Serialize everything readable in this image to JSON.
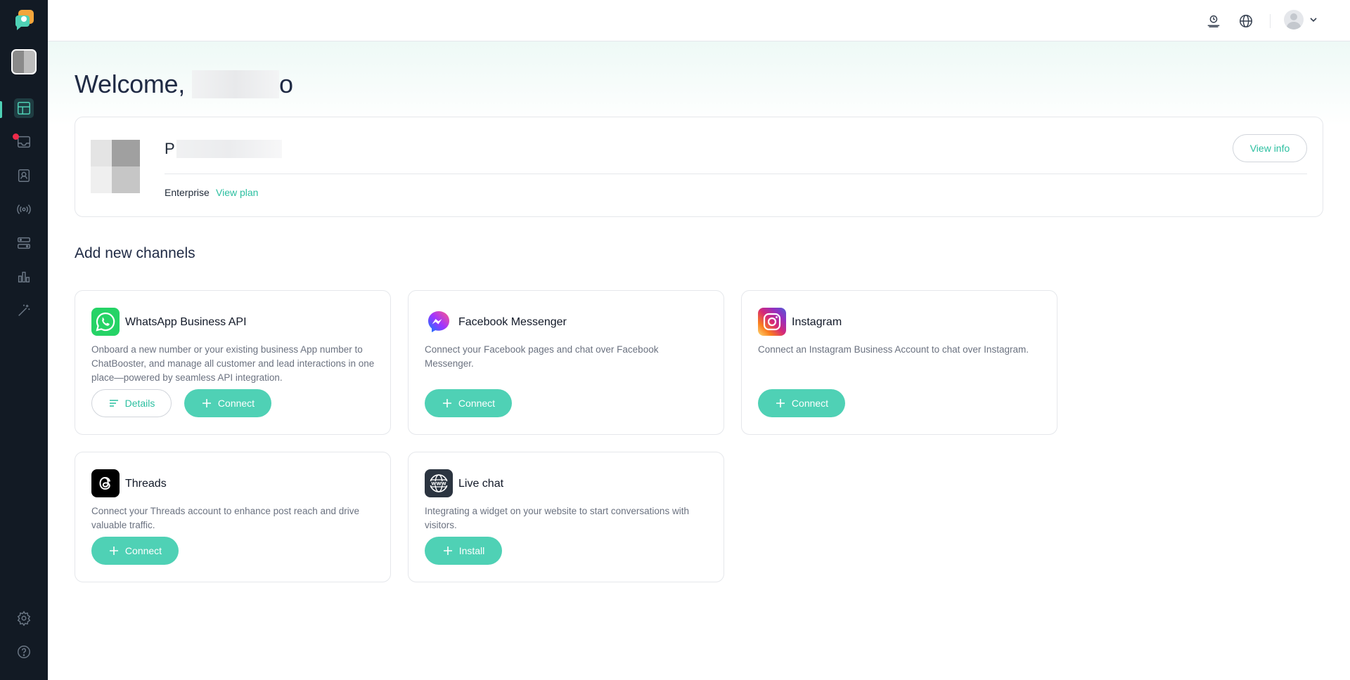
{
  "header": {
    "welcome_prefix": "Welcome,",
    "welcome_suffix": "o"
  },
  "account": {
    "name_initial": "P",
    "plan": "Enterprise",
    "view_plan_label": "View plan",
    "view_info_label": "View info"
  },
  "section": {
    "title": "Add new channels"
  },
  "channels": [
    {
      "title": "WhatsApp Business API",
      "description": "Onboard a new number or your existing business App number to ChatBooster, and manage all customer and lead interactions in one place—powered by seamless API integration.",
      "details_label": "Details",
      "action_label": "Connect",
      "icon": "whatsapp-icon"
    },
    {
      "title": "Facebook Messenger",
      "description": "Connect your Facebook pages and chat over Facebook Messenger.",
      "action_label": "Connect",
      "icon": "messenger-icon"
    },
    {
      "title": "Instagram",
      "description": "Connect an Instagram Business Account to chat over Instagram.",
      "action_label": "Connect",
      "icon": "instagram-icon"
    },
    {
      "title": "Threads",
      "description": "Connect your Threads account to enhance post reach and drive valuable traffic.",
      "action_label": "Connect",
      "icon": "threads-icon"
    },
    {
      "title": "Live chat",
      "description": "Integrating a widget on your website to start conversations with visitors.",
      "action_label": "Install",
      "icon": "www-globe-icon"
    }
  ],
  "colors": {
    "sidebar_bg": "#121a24",
    "accent": "#4fd1b5",
    "accent_text": "#2bbfa0",
    "notification_dot": "#ef2b4a"
  }
}
